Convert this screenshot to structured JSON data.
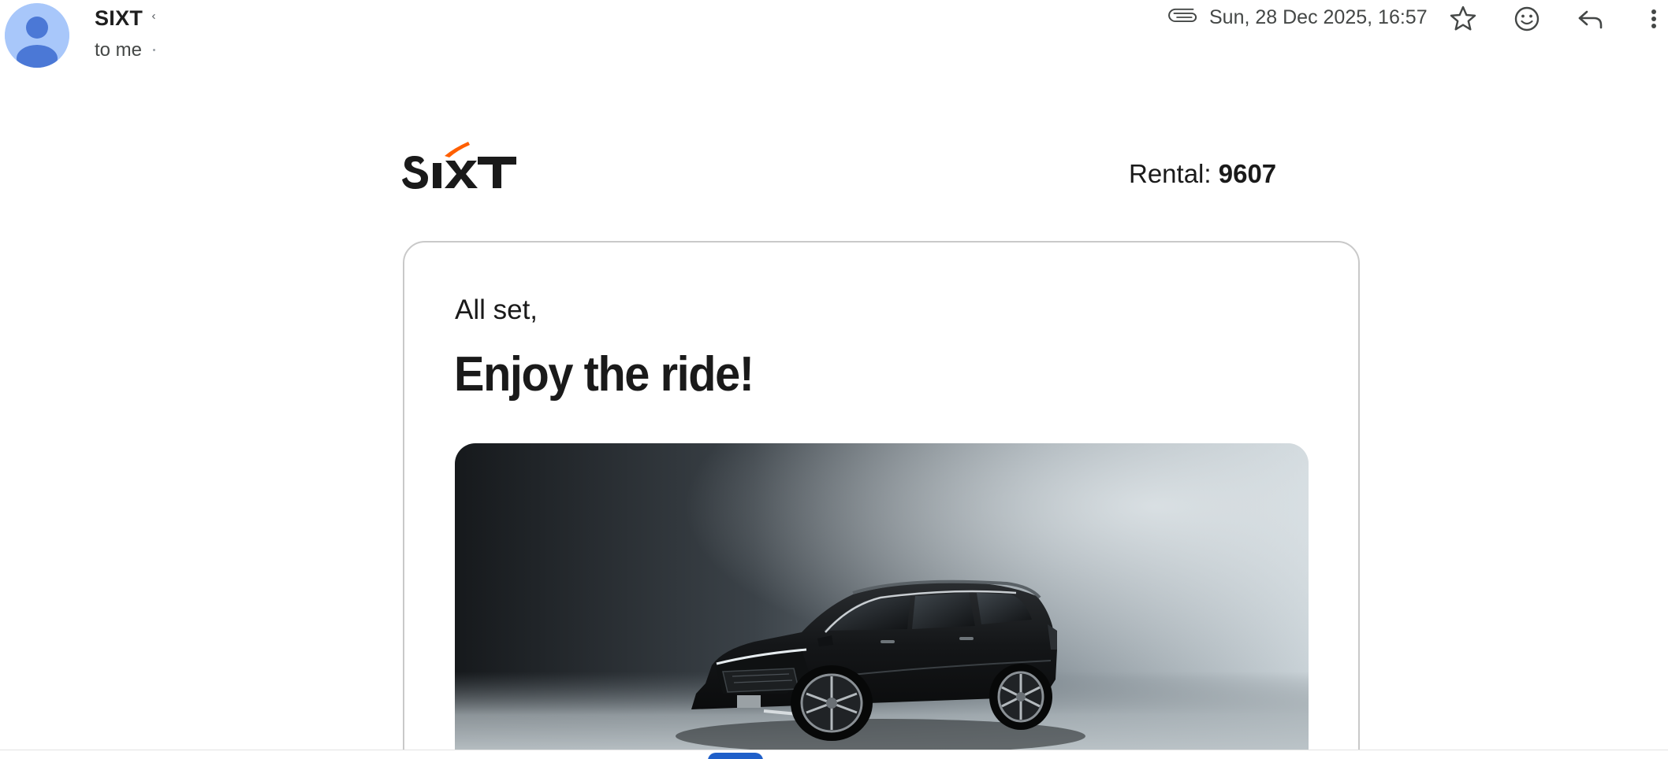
{
  "email": {
    "sender_name": "SIXT",
    "recipient": "to me",
    "date": "Sun, 28 Dec 2025, 16:57"
  },
  "icons": {
    "attachment": "paperclip-icon",
    "star": "star-outline-icon",
    "emoji": "emoji-reaction-icon",
    "reply": "reply-icon",
    "more": "more-vert-icon"
  },
  "body": {
    "logo_text": "SIXT",
    "rental_label": "Rental: ",
    "rental_number": "9607",
    "greeting": "All set,",
    "headline": "Enjoy the ride!",
    "hero_image": "black-suv-photo"
  },
  "colors": {
    "brand_orange": "#ff5f00",
    "text_dark": "#1a1a1a",
    "avatar_bg": "#a8c7fa",
    "avatar_fg": "#4b78d6"
  }
}
